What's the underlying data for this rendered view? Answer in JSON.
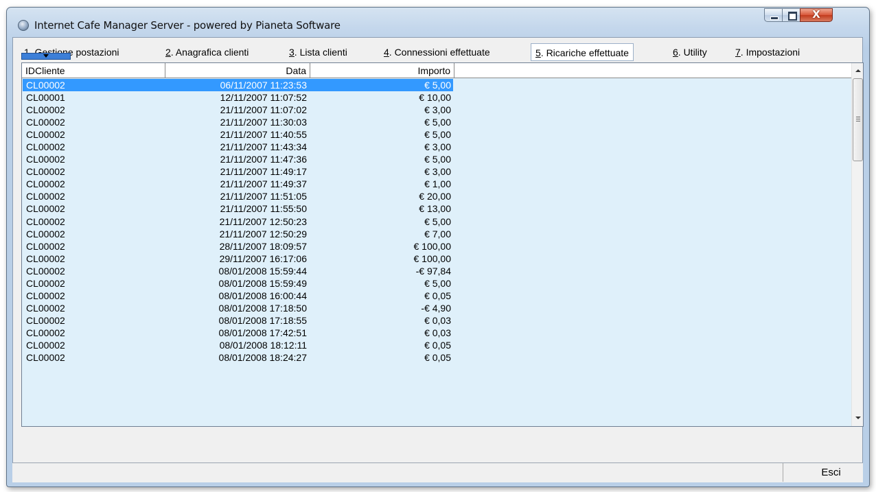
{
  "window": {
    "title": "Internet Cafe Manager Server - powered by Pianeta Software",
    "close_glyph": "X",
    "app_icon": "globe-icon"
  },
  "tabs": [
    {
      "num": "1",
      "label": ". Gestione postazioni"
    },
    {
      "num": "2",
      "label": ". Anagrafica clienti"
    },
    {
      "num": "3",
      "label": ". Lista clienti"
    },
    {
      "num": "4",
      "label": ". Connessioni effettuate"
    },
    {
      "num": "5",
      "label": ". Ricariche effettuate"
    },
    {
      "num": "6",
      "label": ". Utility"
    },
    {
      "num": "7",
      "label": ". Impostazioni"
    }
  ],
  "active_tab": "5",
  "table": {
    "columns": [
      "IDCliente",
      "Data",
      "Importo"
    ],
    "rows": [
      [
        "CL00002",
        "06/11/2007 11:23:53",
        "€ 5,00"
      ],
      [
        "CL00001",
        "12/11/2007 11:07:52",
        "€ 10,00"
      ],
      [
        "CL00002",
        "21/11/2007 11:07:02",
        "€ 3,00"
      ],
      [
        "CL00002",
        "21/11/2007 11:30:03",
        "€ 5,00"
      ],
      [
        "CL00002",
        "21/11/2007 11:40:55",
        "€ 5,00"
      ],
      [
        "CL00002",
        "21/11/2007 11:43:34",
        "€ 3,00"
      ],
      [
        "CL00002",
        "21/11/2007 11:47:36",
        "€ 5,00"
      ],
      [
        "CL00002",
        "21/11/2007 11:49:17",
        "€ 3,00"
      ],
      [
        "CL00002",
        "21/11/2007 11:49:37",
        "€ 1,00"
      ],
      [
        "CL00002",
        "21/11/2007 11:51:05",
        "€ 20,00"
      ],
      [
        "CL00002",
        "21/11/2007 11:55:50",
        "€ 13,00"
      ],
      [
        "CL00002",
        "21/11/2007 12:50:23",
        "€ 5,00"
      ],
      [
        "CL00002",
        "21/11/2007 12:50:29",
        "€ 7,00"
      ],
      [
        "CL00002",
        "28/11/2007 18:09:57",
        "€ 100,00"
      ],
      [
        "CL00002",
        "29/11/2007 16:17:06",
        "€ 100,00"
      ],
      [
        "CL00002",
        "08/01/2008 15:59:44",
        "-€ 97,84"
      ],
      [
        "CL00002",
        "08/01/2008 15:59:49",
        "€ 5,00"
      ],
      [
        "CL00002",
        "08/01/2008 16:00:44",
        "€ 0,05"
      ],
      [
        "CL00002",
        "08/01/2008 17:18:50",
        "-€ 4,90"
      ],
      [
        "CL00002",
        "08/01/2008 17:18:55",
        "€ 0,03"
      ],
      [
        "CL00002",
        "08/01/2008 17:42:51",
        "€ 0,03"
      ],
      [
        "CL00002",
        "08/01/2008 18:12:11",
        "€ 0,05"
      ],
      [
        "CL00002",
        "08/01/2008 18:24:27",
        "€ 0,05"
      ]
    ],
    "selected_row": 0
  },
  "footer": {
    "esci_label": "Esci"
  },
  "colors": {
    "grid_background": "#dff0fa",
    "selection": "#3399ff",
    "collapse_button": "#3c7fd8"
  }
}
